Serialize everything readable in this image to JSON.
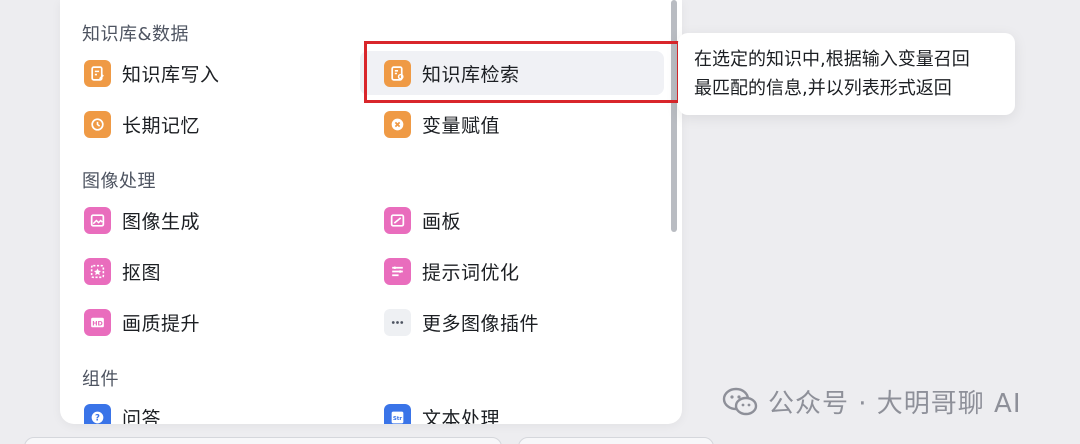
{
  "sections": [
    {
      "title": "知识库&数据"
    },
    {
      "title": "图像处理"
    },
    {
      "title": "组件"
    }
  ],
  "items": {
    "knowledge_write": {
      "label": "知识库写入",
      "icon": "knowledge-write-icon",
      "color": "#ef9a45"
    },
    "knowledge_search": {
      "label": "知识库检索",
      "icon": "knowledge-search-icon",
      "color": "#ef9a45"
    },
    "long_term_memory": {
      "label": "长期记忆",
      "icon": "memory-icon",
      "color": "#ef9a45"
    },
    "variable_assign": {
      "label": "变量赋值",
      "icon": "variable-icon",
      "color": "#ef9a45"
    },
    "image_generate": {
      "label": "图像生成",
      "icon": "image-generate-icon",
      "color": "#e96dbd"
    },
    "canvas": {
      "label": "画板",
      "icon": "canvas-icon",
      "color": "#e96dbd"
    },
    "cutout": {
      "label": "抠图",
      "icon": "cutout-icon",
      "color": "#e96dbd"
    },
    "prompt_optimize": {
      "label": "提示词优化",
      "icon": "prompt-optimize-icon",
      "color": "#e96dbd"
    },
    "quality_upscale": {
      "label": "画质提升",
      "icon": "hd-icon",
      "color": "#e96dbd"
    },
    "more_image_plugins": {
      "label": "更多图像插件",
      "icon": "more-icon",
      "color": "#eef0f3"
    },
    "qa": {
      "label": "问答",
      "icon": "question-icon",
      "color": "#3a74e8"
    },
    "text_process": {
      "label": "文本处理",
      "icon": "text-process-icon",
      "color": "#3a74e8"
    }
  },
  "tooltip": {
    "line1": "在选定的知识中,根据输入变量召回",
    "line2": "最匹配的信息,并以列表形式返回"
  },
  "watermark": {
    "text": "公众号 · 大明哥聊 AI",
    "icon": "wechat-icon"
  },
  "colors": {
    "highlight": "#d9262b",
    "orange": "#ef9a45",
    "pink": "#e96dbd",
    "blue": "#3a74e8"
  }
}
